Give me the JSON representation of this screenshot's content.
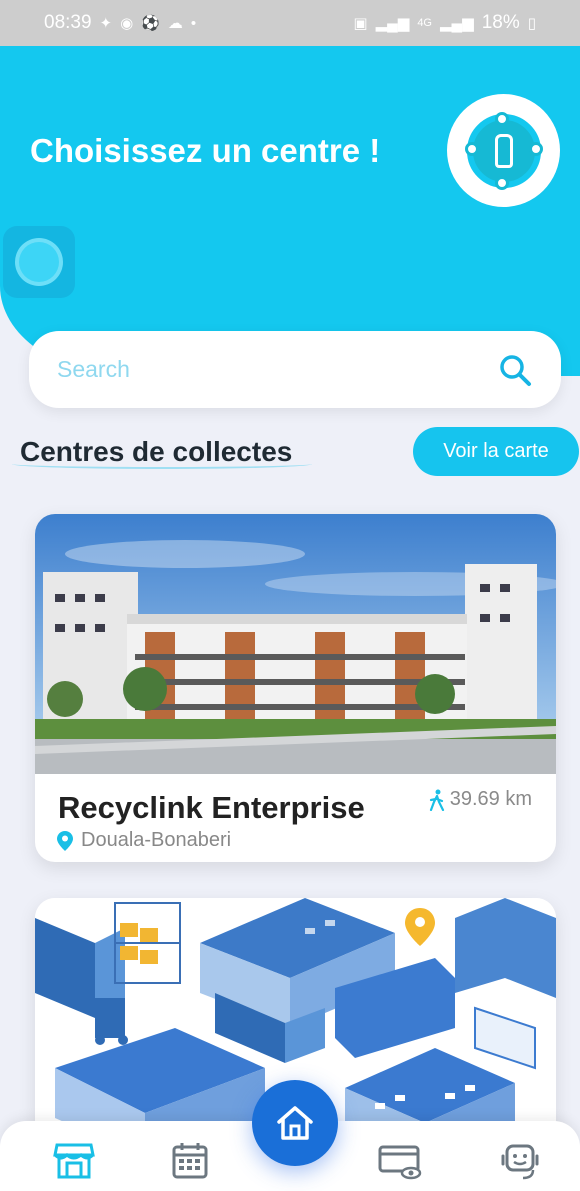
{
  "status_bar": {
    "time": "08:39",
    "signal_label": "4G",
    "battery": "18%"
  },
  "header": {
    "title": "Choisissez un centre !"
  },
  "search": {
    "placeholder": "Search",
    "value": ""
  },
  "section": {
    "title": "Centres de collectes",
    "map_button": "Voir la carte"
  },
  "centers": [
    {
      "name": "Recyclink Enterprise",
      "location": "Douala-Bonaberi",
      "distance": "39.69 km"
    }
  ],
  "colors": {
    "accent": "#14c8ef",
    "primary_fab": "#1a6fd8",
    "background": "#eef0f8"
  },
  "nav": {
    "items": [
      "store-icon",
      "calendar-icon",
      "home-icon",
      "card-eye-icon",
      "support-icon"
    ]
  }
}
